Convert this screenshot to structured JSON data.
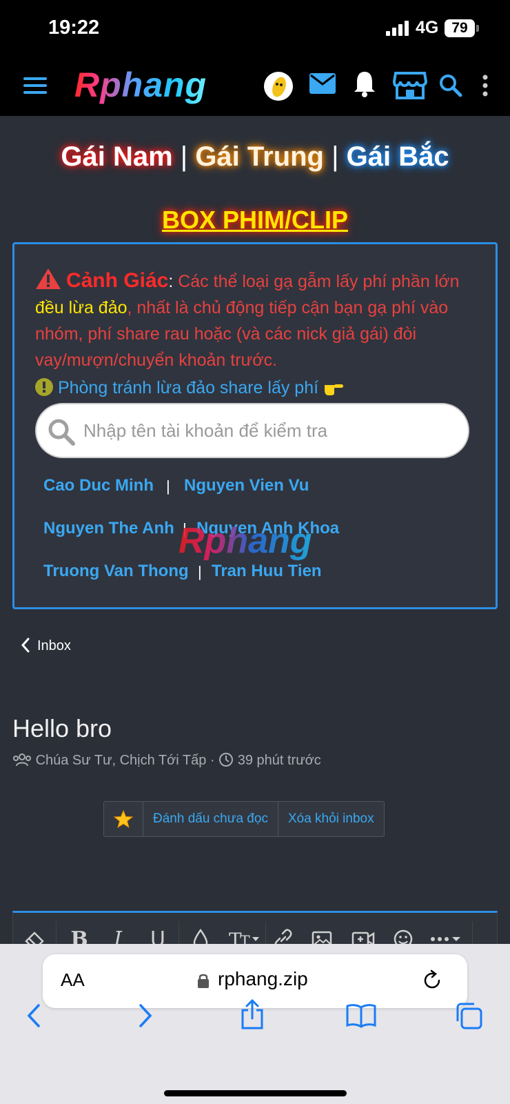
{
  "status_bar": {
    "time": "19:22",
    "network": "4G",
    "battery": "79"
  },
  "header": {
    "logo": "Rphang"
  },
  "regions": {
    "south": "Gái Nam",
    "central": "Gái Trung",
    "north": "Gái Bắc",
    "separator": "|"
  },
  "box_title": "BOX PHIM/CLIP",
  "warning": {
    "heading": "Cảnh Giác",
    "colon": ":",
    "text1": " Các thể loại gạ gẫm lấy phí phần lớn ",
    "highlight": "đều lừa đảo",
    "text2": ", nhất là chủ động tiếp cận bạn gạ phí vào nhóm, phí share rau hoặc (và các nick giả gái) đòi vay/mượn/chuyển khoản trước.",
    "tip": "Phòng tránh lừa đảo share lấy phí"
  },
  "search": {
    "placeholder": "Nhập tên tài khoản để kiểm tra"
  },
  "names": [
    "Cao Duc Minh",
    "Nguyen Vien Vu",
    "Nguyen The Anh",
    "Nguyen Anh Khoa",
    "Truong Van Thong",
    "Tran Huu Tien"
  ],
  "watermark": "Rphang",
  "breadcrumb": {
    "label": "Inbox"
  },
  "conversation": {
    "title": "Hello bro",
    "participants": "Chúa Sư Tư, Chịch Tới Tấp",
    "separator": "·",
    "time": "39 phút trước"
  },
  "actions": {
    "mark_unread": "Đánh dấu chưa đọc",
    "remove": "Xóa khỏi inbox"
  },
  "safari": {
    "text_size": "AA",
    "url": "rphang.zip"
  },
  "colors": {
    "accent": "#2b8fe6",
    "link": "#3aa8f2",
    "warning": "#e8413f",
    "highlight": "#ffe600"
  }
}
